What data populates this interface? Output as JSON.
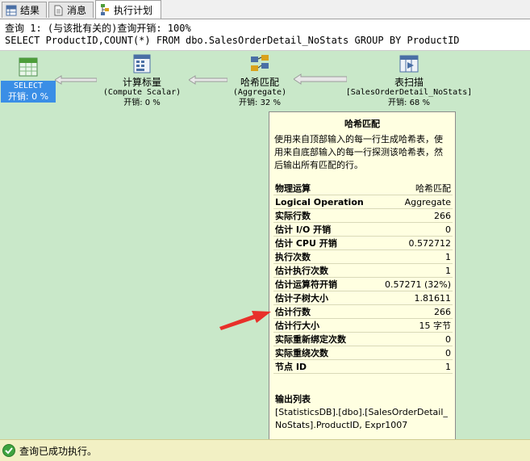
{
  "tabs": [
    {
      "label": "结果",
      "icon": "grid-icon"
    },
    {
      "label": "消息",
      "icon": "document-icon"
    },
    {
      "label": "执行计划",
      "icon": "execution-plan-icon"
    }
  ],
  "plan": {
    "query_line": "查询 1: (与该批有关的)查询开销: 100%",
    "sql_line": "SELECT ProductID,COUNT(*) FROM dbo.SalesOrderDetail_NoStats GROUP BY ProductID"
  },
  "operators": {
    "select": {
      "label": "SELECT",
      "cost": "开销: 0 %"
    },
    "compute_scalar": {
      "label": "计算标量",
      "sub": "(Compute Scalar)",
      "cost": "开销: 0 %"
    },
    "hash_match": {
      "label": "哈希匹配",
      "sub": "(Aggregate)",
      "cost": "开销: 32 %"
    },
    "table_scan": {
      "label": "表扫描",
      "sub": "[SalesOrderDetail_NoStats]",
      "cost": "开销: 68 %"
    }
  },
  "tooltip": {
    "title": "哈希匹配",
    "description": "使用来自顶部输入的每一行生成哈希表，使用来自底部输入的每一行探测该哈希表，然后输出所有匹配的行。",
    "rows": [
      {
        "key": "物理运算",
        "value": "哈希匹配"
      },
      {
        "key": "Logical Operation",
        "value": "Aggregate"
      },
      {
        "key": "实际行数",
        "value": "266"
      },
      {
        "key": "估计 I/O 开销",
        "value": "0"
      },
      {
        "key": "估计 CPU 开销",
        "value": "0.572712"
      },
      {
        "key": "执行次数",
        "value": "1"
      },
      {
        "key": "估计执行次数",
        "value": "1"
      },
      {
        "key": "估计运算符开销",
        "value": "0.57271 (32%)"
      },
      {
        "key": "估计子树大小",
        "value": "1.81611"
      },
      {
        "key": "估计行数",
        "value": "266"
      },
      {
        "key": "估计行大小",
        "value": "15 字节"
      },
      {
        "key": "实际重新绑定次数",
        "value": "0"
      },
      {
        "key": "实际重绕次数",
        "value": "0"
      },
      {
        "key": "节点 ID",
        "value": "1"
      }
    ],
    "output_heading": "输出列表",
    "output_list": "[StatisticsDB].[dbo].[SalesOrderDetail_NoStats].ProductID, Expr1007"
  },
  "status": {
    "text": "查询已成功执行。",
    "icon": "check-circle-icon"
  },
  "colors": {
    "plan_bg": "#c9e8c9",
    "select_highlight": "#3a8ee6",
    "tooltip_bg": "#ffffe1",
    "annotation_arrow": "#e8302a",
    "status_bg": "#f2f0c4"
  }
}
